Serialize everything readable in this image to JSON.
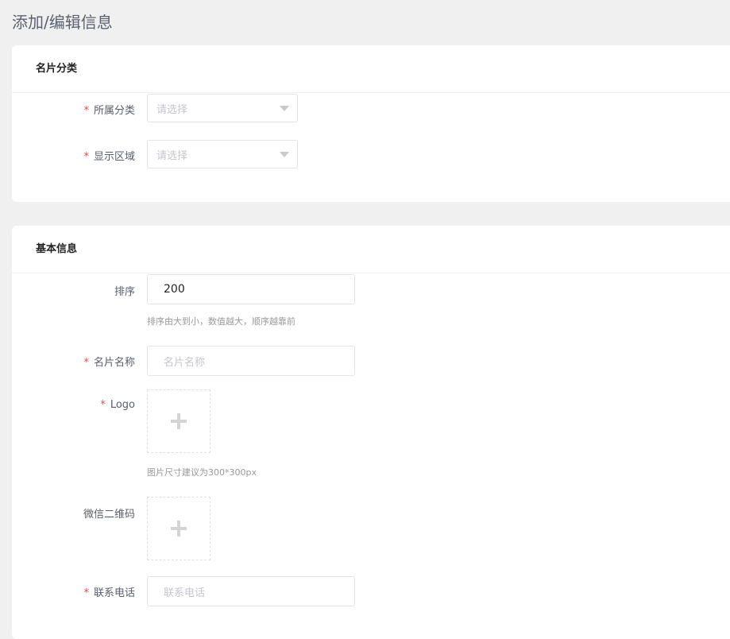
{
  "page_title": "添加/编辑信息",
  "section_category": {
    "title": "名片分类",
    "fields": [
      {
        "label": "所属分类",
        "required": "*",
        "placeholder": "请选择"
      },
      {
        "label": "显示区域",
        "required": "*",
        "placeholder": "请选择"
      }
    ]
  },
  "section_basic": {
    "title": "基本信息",
    "sort": {
      "label": "排序",
      "value": "200",
      "hint": "排序由大到小，数值越大，顺序越靠前"
    },
    "name": {
      "label": "名片名称",
      "required": "*",
      "placeholder": "名片名称"
    },
    "logo": {
      "label": "Logo",
      "required": "*",
      "hint": "图片尺寸建议为300*300px"
    },
    "wechat_qr": {
      "label": "微信二维码"
    },
    "phone": {
      "label": "联系电话",
      "required": "*",
      "placeholder": "联系电话"
    }
  }
}
